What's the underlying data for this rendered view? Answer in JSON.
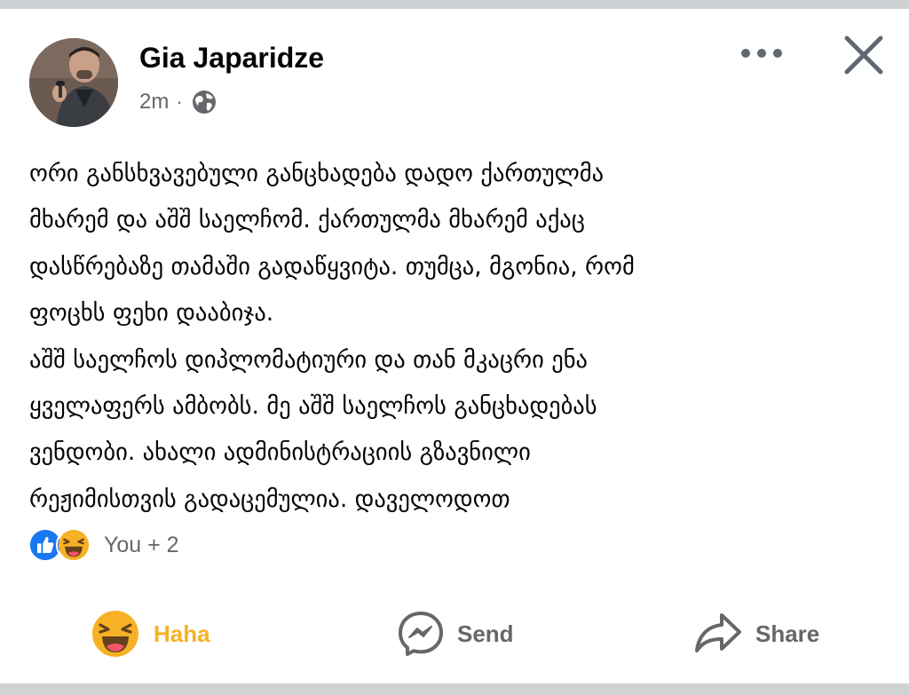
{
  "post": {
    "author": "Gia Japaridze",
    "time": "2m",
    "separator": "·",
    "privacy_icon": "globe-icon",
    "text_lines": [
      "ორი განსხვავებული განცხადება დადო ქართულმა",
      "მხარემ და აშშ საელჩომ. ქართულმა მხარემ აქაც",
      "დასწრებაზე თამაში გადაწყვიტა. თუმცა, მგონია, რომ",
      "ფოცხს ფეხი დააბიჯა.",
      "აშშ საელჩოს დიპლომატიური და თან მკაცრი ენა",
      "ყველაფერს ამბობს. მე აშშ საელჩოს განცხადებას",
      "ვენდობი.  ახალი ადმინისტრაციის გზავნილი",
      "რეჟიმისთვის გადაცემულია. დაველოდოთ"
    ]
  },
  "reactions": {
    "icons": [
      "like-icon",
      "haha-icon"
    ],
    "summary": "You + 2"
  },
  "actions": {
    "haha_label": "Haha",
    "send_label": "Send",
    "share_label": "Share"
  },
  "colors": {
    "text": "#050505",
    "secondary": "#65676b",
    "haha_accent": "#f7b125",
    "like_blue": "#1877f2",
    "strip": "#cfd2d5"
  }
}
